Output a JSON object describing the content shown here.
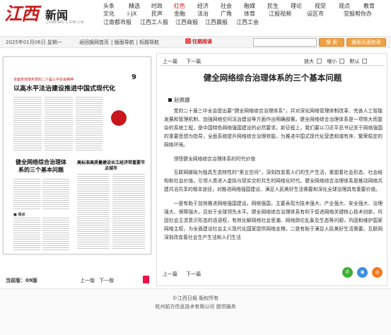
{
  "header": {
    "logo_cn": "江西",
    "logo_xinwen": "新闻",
    "logo_domain": "JXNEWS.COM.CN",
    "nav_rows": [
      [
        {
          "label": "头条",
          "red": false
        },
        {
          "label": "精选",
          "red": false
        },
        {
          "label": "时政",
          "red": false
        },
        {
          "label": "红色",
          "red": true
        },
        {
          "label": "经济",
          "red": false
        },
        {
          "label": "社会",
          "red": false
        },
        {
          "label": "融媒",
          "red": false
        },
        {
          "label": "民生",
          "red": false
        },
        {
          "label": "理论",
          "red": false
        },
        {
          "label": "视觉",
          "red": false
        },
        {
          "label": "观点",
          "red": false
        },
        {
          "label": "教育",
          "red": false
        }
      ],
      [
        {
          "label": "文化",
          "red": false
        },
        {
          "label": "i-JX",
          "red": false
        },
        {
          "label": "民声",
          "red": false
        },
        {
          "label": "金融",
          "red": false
        },
        {
          "label": "法治",
          "red": false
        },
        {
          "label": "广角",
          "red": false
        },
        {
          "label": "体育",
          "red": false
        },
        {
          "label": "江报视频",
          "red": false
        },
        {
          "label": "设区市",
          "red": false
        },
        {
          "label": "党报帮你办",
          "red": false
        }
      ],
      [
        {
          "label": "江南都市报",
          "red": false
        },
        {
          "label": "江西工人报",
          "red": false
        },
        {
          "label": "江西商报",
          "red": false
        },
        {
          "label": "江西晨报",
          "red": false
        },
        {
          "label": "江西工会",
          "red": false
        }
      ]
    ]
  },
  "toolbar": {
    "date": "2025年01月06日 星期一",
    "crumbs": [
      "返回报网首页",
      "版面导航",
      "标题导航"
    ],
    "past_label": "往期阅读",
    "search_value": "",
    "search_btn": "搜 索",
    "adv_btn": "搜索页面检索"
  },
  "paper": {
    "top_red": "全面贯彻落实党的二十届三中全会精神",
    "page_no": "9",
    "headline": "以高水平法治建设推进中国式现代化",
    "column_head": "学习 思 悟",
    "sub_headline_left": "健全网络综合治理体系的三个基本问题",
    "sub_headline_right": "高标准高质量建设长江经济带重要节点城市",
    "small_head": "■ 观点",
    "edition": "当前版：09版",
    "prev_page": "上一版",
    "next_page": "下一版"
  },
  "article": {
    "top_prev": "上一篇",
    "top_next": "下一篇",
    "zoom_in": "放大",
    "zoom_out": "缩小",
    "default": "默认",
    "title": "健全网络综合治理体系的三个基本问题",
    "author": "赵佩娜",
    "paragraphs": [
      "党的二十届三中全会提出要“健全网络综合治理体系”，并对深化网络管理体制改革、完善人工智能发展和管理机制、加强网络空间法治建设等方面作出明确部署。健全网络综合治理体系是一项恢大而复杂的系统工程，是中国特色网络强国建设的必然要求。新征程上，我们要以习近平总书记关于网络强国的重要思想为指导，全面系统提升网络综合治理效能，为推进中国式现代化营造和谐有序、繁荣稳定的网络环境。",
      "领悟健全网络综合治理体系的时代价值",
      "互联网被喻为独具生态特性的“第五空间”，深刻改变着人们的生产生活，重塑着社会形态、社会结构和社会价值，引领人类进入虚拟与现实交织共生的网络化时代。健全网络综合治理体系是推动网络共建共治共享的根本途径，对推进网络强国建设、满足人民美好生活需要和深化全球治理具有重要价值。",
      "一是有助于加快推进网络强国建设。网络强国，主要表现为技术强大、产业强大、安全强大、治理强大、保障强大，且处于全球领先水平。健全网络综合治理体系有利于促进网络关键核心技术创新，巩固社会主流意识形态的话语权，有效化解网络社会思潮、网络舆论乱象及生态等问题，巩固和维护国家网络主权，为全面建设社会主义现代化国家提供网络支撑。二是有助于满足人民美好生活需要。互联网深刻改变着社会生产生活和人们生活"
    ],
    "bottom_prev": "上一篇",
    "bottom_next": "下一篇"
  },
  "footer": {
    "line1": "©江西日报 版权所有",
    "line2": "杭州前方信息技术有限公司  提供服务"
  },
  "colors": {
    "brand_red": "#c8161d",
    "button_orange": "#f0a040",
    "wechat_green": "#3cb034",
    "qq_blue": "#3a8ee0",
    "weibo_orange": "#f07a24"
  }
}
